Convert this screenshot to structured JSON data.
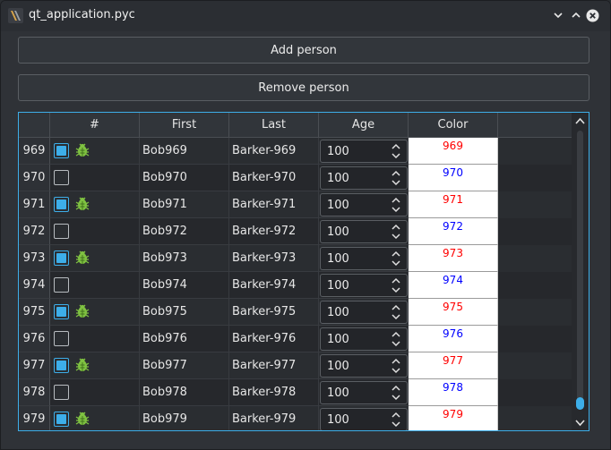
{
  "window": {
    "title": "qt_application.pyc",
    "controls": [
      "minimize-icon",
      "maximize-icon",
      "close-icon"
    ]
  },
  "buttons": {
    "add_label": "Add person",
    "remove_label": "Remove person"
  },
  "table": {
    "headers": [
      "#",
      "First",
      "Last",
      "Age",
      "Color"
    ],
    "rows": [
      {
        "num": "969",
        "checked": true,
        "bug": true,
        "first": "Bob969",
        "last": "Barker-969",
        "age": "100",
        "color_text": "969",
        "color": "#ff0000"
      },
      {
        "num": "970",
        "checked": false,
        "bug": false,
        "first": "Bob970",
        "last": "Barker-970",
        "age": "100",
        "color_text": "970",
        "color": "#0000ff"
      },
      {
        "num": "971",
        "checked": true,
        "bug": true,
        "first": "Bob971",
        "last": "Barker-971",
        "age": "100",
        "color_text": "971",
        "color": "#ff0000"
      },
      {
        "num": "972",
        "checked": false,
        "bug": false,
        "first": "Bob972",
        "last": "Barker-972",
        "age": "100",
        "color_text": "972",
        "color": "#0000ff"
      },
      {
        "num": "973",
        "checked": true,
        "bug": true,
        "first": "Bob973",
        "last": "Barker-973",
        "age": "100",
        "color_text": "973",
        "color": "#ff0000"
      },
      {
        "num": "974",
        "checked": false,
        "bug": false,
        "first": "Bob974",
        "last": "Barker-974",
        "age": "100",
        "color_text": "974",
        "color": "#0000ff"
      },
      {
        "num": "975",
        "checked": true,
        "bug": true,
        "first": "Bob975",
        "last": "Barker-975",
        "age": "100",
        "color_text": "975",
        "color": "#ff0000"
      },
      {
        "num": "976",
        "checked": false,
        "bug": false,
        "first": "Bob976",
        "last": "Barker-976",
        "age": "100",
        "color_text": "976",
        "color": "#0000ff"
      },
      {
        "num": "977",
        "checked": true,
        "bug": true,
        "first": "Bob977",
        "last": "Barker-977",
        "age": "100",
        "color_text": "977",
        "color": "#ff0000"
      },
      {
        "num": "978",
        "checked": false,
        "bug": false,
        "first": "Bob978",
        "last": "Barker-978",
        "age": "100",
        "color_text": "978",
        "color": "#0000ff"
      },
      {
        "num": "979",
        "checked": true,
        "bug": true,
        "first": "Bob979",
        "last": "Barker-979",
        "age": "100",
        "color_text": "979",
        "color": "#ff0000"
      }
    ]
  },
  "scroll_position": 0.98,
  "colors": {
    "accent": "#3daee9",
    "odd_text": "#ff0000",
    "even_text": "#0000ff",
    "bug_green": "#7fc241"
  }
}
